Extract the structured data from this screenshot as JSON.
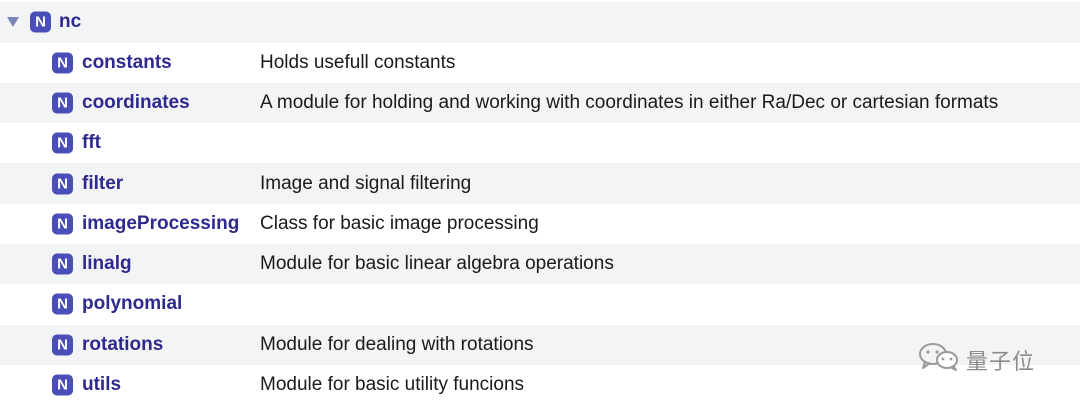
{
  "tree": {
    "root": {
      "badge": "N",
      "name": "nc",
      "expanded": true
    },
    "children": [
      {
        "badge": "N",
        "name": "constants",
        "description": "Holds usefull constants"
      },
      {
        "badge": "N",
        "name": "coordinates",
        "description": "A module for holding and working with coordinates in either Ra/Dec or cartesian formats"
      },
      {
        "badge": "N",
        "name": "fft",
        "description": ""
      },
      {
        "badge": "N",
        "name": "filter",
        "description": "Image and signal filtering"
      },
      {
        "badge": "N",
        "name": "imageProcessing",
        "description": "Class for basic image processing"
      },
      {
        "badge": "N",
        "name": "linalg",
        "description": "Module for basic linear algebra operations"
      },
      {
        "badge": "N",
        "name": "polynomial",
        "description": ""
      },
      {
        "badge": "N",
        "name": "rotations",
        "description": "Module for dealing with rotations"
      },
      {
        "badge": "N",
        "name": "utils",
        "description": "Module for basic utility funcions"
      }
    ]
  },
  "watermark": {
    "text": "量子位",
    "icon": "wechat-icon"
  },
  "colors": {
    "badge_bg": "#4a4fb8",
    "name_text": "#2d2a8e",
    "alt_row_bg": "#f3f4f6",
    "disclosure": "#7d86b8"
  }
}
